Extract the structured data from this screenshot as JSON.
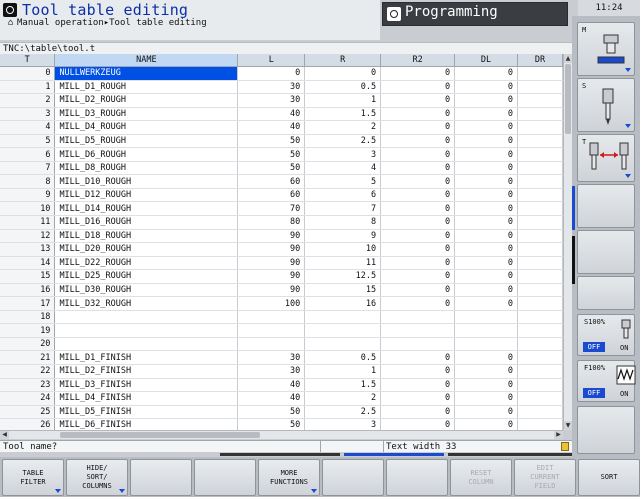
{
  "header": {
    "title": "Tool table editing",
    "breadcrumb": "Manual operation▸Tool table editing",
    "program_mode": "Programming",
    "clock": "11:24"
  },
  "path": "TNC:\\table\\tool.t",
  "table": {
    "columns": [
      "T",
      "NAME",
      "L",
      "R",
      "R2",
      "DL",
      "DR"
    ],
    "rows": [
      [
        "0",
        "NULLWERKZEUG",
        "0",
        "0",
        "0",
        "0",
        ""
      ],
      [
        "1",
        "MILL_D1_ROUGH",
        "30",
        "0.5",
        "0",
        "0",
        ""
      ],
      [
        "2",
        "MILL_D2_ROUGH",
        "30",
        "1",
        "0",
        "0",
        ""
      ],
      [
        "3",
        "MILL_D3_ROUGH",
        "40",
        "1.5",
        "0",
        "0",
        ""
      ],
      [
        "4",
        "MILL_D4_ROUGH",
        "40",
        "2",
        "0",
        "0",
        ""
      ],
      [
        "5",
        "MILL_D5_ROUGH",
        "50",
        "2.5",
        "0",
        "0",
        ""
      ],
      [
        "6",
        "MILL_D6_ROUGH",
        "50",
        "3",
        "0",
        "0",
        ""
      ],
      [
        "7",
        "MILL_D8_ROUGH",
        "50",
        "4",
        "0",
        "0",
        ""
      ],
      [
        "8",
        "MILL_D10_ROUGH",
        "60",
        "5",
        "0",
        "0",
        ""
      ],
      [
        "9",
        "MILL_D12_ROUGH",
        "60",
        "6",
        "0",
        "0",
        ""
      ],
      [
        "10",
        "MILL_D14_ROUGH",
        "70",
        "7",
        "0",
        "0",
        ""
      ],
      [
        "11",
        "MILL_D16_ROUGH",
        "80",
        "8",
        "0",
        "0",
        ""
      ],
      [
        "12",
        "MILL_D18_ROUGH",
        "90",
        "9",
        "0",
        "0",
        ""
      ],
      [
        "13",
        "MILL_D20_ROUGH",
        "90",
        "10",
        "0",
        "0",
        ""
      ],
      [
        "14",
        "MILL_D22_ROUGH",
        "90",
        "11",
        "0",
        "0",
        ""
      ],
      [
        "15",
        "MILL_D25_ROUGH",
        "90",
        "12.5",
        "0",
        "0",
        ""
      ],
      [
        "16",
        "MILL_D30_ROUGH",
        "90",
        "15",
        "0",
        "0",
        ""
      ],
      [
        "17",
        "MILL_D32_ROUGH",
        "100",
        "16",
        "0",
        "0",
        ""
      ],
      [
        "18",
        "",
        "",
        "",
        "",
        "",
        ""
      ],
      [
        "19",
        "",
        "",
        "",
        "",
        "",
        ""
      ],
      [
        "20",
        "",
        "",
        "",
        "",
        "",
        ""
      ],
      [
        "21",
        "MILL_D1_FINISH",
        "30",
        "0.5",
        "0",
        "0",
        ""
      ],
      [
        "22",
        "MILL_D2_FINISH",
        "30",
        "1",
        "0",
        "0",
        ""
      ],
      [
        "23",
        "MILL_D3_FINISH",
        "40",
        "1.5",
        "0",
        "0",
        ""
      ],
      [
        "24",
        "MILL_D4_FINISH",
        "40",
        "2",
        "0",
        "0",
        ""
      ],
      [
        "25",
        "MILL_D5_FINISH",
        "50",
        "2.5",
        "0",
        "0",
        ""
      ],
      [
        "26",
        "MILL_D6_FINISH",
        "50",
        "3",
        "0",
        "0",
        ""
      ]
    ]
  },
  "status": {
    "prompt": "Tool name?",
    "text_width": "Text width 33"
  },
  "softkeys": [
    {
      "label": "TABLE\nFILTER",
      "enabled": true,
      "submenu": true
    },
    {
      "label": "HIDE/\nSORT/\nCOLUMNS",
      "enabled": true,
      "submenu": true
    },
    {
      "label": "",
      "enabled": true,
      "submenu": false
    },
    {
      "label": "",
      "enabled": true,
      "submenu": false
    },
    {
      "label": "MORE\nFUNCTIONS",
      "enabled": true,
      "submenu": true
    },
    {
      "label": "",
      "enabled": true,
      "submenu": false
    },
    {
      "label": "",
      "enabled": true,
      "submenu": false
    },
    {
      "label": "RESET\nCOLUMN",
      "enabled": false,
      "submenu": false
    },
    {
      "label": "EDIT\nCURRENT\nFIELD",
      "enabled": false,
      "submenu": false
    },
    {
      "label": "SORT",
      "enabled": true,
      "submenu": false
    }
  ],
  "side_keys": {
    "m_label": "M",
    "s_label": "S",
    "t_label": "T",
    "s_override": "S100%",
    "f_override": "F100%",
    "off": "OFF",
    "on": "ON"
  },
  "colors": {
    "accent": "#1a4ad0",
    "highlight": "#0050e6",
    "title": "#0b2fa8",
    "header_bg": "#3a3d42"
  }
}
